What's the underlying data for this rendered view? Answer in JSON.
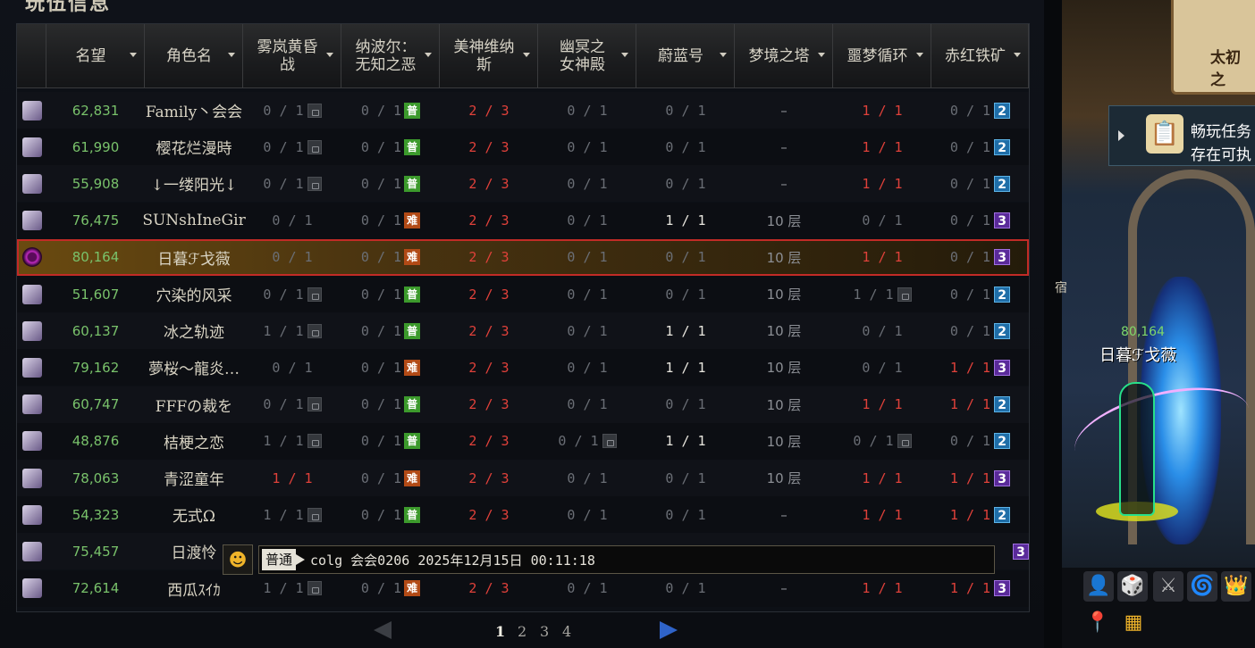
{
  "panel_title": "玩伍信息",
  "headers": [
    {
      "key": "avatar",
      "label": ""
    },
    {
      "key": "fame",
      "label": "名望"
    },
    {
      "key": "name",
      "label": "角色名"
    },
    {
      "key": "c1",
      "label": "雾岚黄昏\n战"
    },
    {
      "key": "c2",
      "label": "纳波尔：\n无知之恶"
    },
    {
      "key": "c3",
      "label": "美神维纳\n斯"
    },
    {
      "key": "c4",
      "label": "幽冥之\n女神殿"
    },
    {
      "key": "c5",
      "label": "蔚蓝号"
    },
    {
      "key": "c6",
      "label": "梦境之塔"
    },
    {
      "key": "c7",
      "label": "噩梦循环"
    },
    {
      "key": "c8",
      "label": "赤红铁矿"
    }
  ],
  "rows": [
    {
      "fame": "62,831",
      "name": "Family丶会会",
      "c1": "0 / 1",
      "c1_lock": true,
      "c2": "0 / 1",
      "c2_badge": "普",
      "c3": "2 / 3",
      "c4": "0 / 1",
      "c5": "0 / 1",
      "c6": "–",
      "c7": "1 / 1",
      "c8": "0 / 1",
      "lv": "2"
    },
    {
      "fame": "61,990",
      "name": "樱花烂漫時",
      "c1": "0 / 1",
      "c1_lock": true,
      "c2": "0 / 1",
      "c2_badge": "普",
      "c3": "2 / 3",
      "c4": "0 / 1",
      "c5": "0 / 1",
      "c6": "–",
      "c7": "1 / 1",
      "c8": "0 / 1",
      "lv": "2"
    },
    {
      "fame": "55,908",
      "name": "↓一缕阳光↓",
      "c1": "0 / 1",
      "c1_lock": true,
      "c2": "0 / 1",
      "c2_badge": "普",
      "c3": "2 / 3",
      "c4": "0 / 1",
      "c5": "0 / 1",
      "c6": "–",
      "c7": "1 / 1",
      "c8": "0 / 1",
      "lv": "2"
    },
    {
      "fame": "76,475",
      "name": "SUNshIneGir",
      "c1": "0 / 1",
      "c1_lock": false,
      "c2": "0 / 1",
      "c2_badge": "难",
      "c3": "2 / 3",
      "c4": "0 / 1",
      "c5": "1 / 1",
      "c6": "10 层",
      "c7": "0 / 1",
      "c8": "0 / 1",
      "lv": "3"
    },
    {
      "fame": "80,164",
      "name": "日暮ℱ戈薇",
      "c1": "0 / 1",
      "c1_lock": false,
      "c2": "0 / 1",
      "c2_badge": "难",
      "c3": "2 / 3",
      "c4": "0 / 1",
      "c5": "0 / 1",
      "c6": "10 层",
      "c7": "1 / 1",
      "c8": "0 / 1",
      "lv": "3",
      "selected": true
    },
    {
      "fame": "51,607",
      "name": "穴染的风采",
      "c1": "0 / 1",
      "c1_lock": true,
      "c2": "0 / 1",
      "c2_badge": "普",
      "c3": "2 / 3",
      "c4": "0 / 1",
      "c5": "0 / 1",
      "c6": "10 层",
      "c7": "1 / 1",
      "c7_lock": true,
      "c8": "0 / 1",
      "lv": "2"
    },
    {
      "fame": "60,137",
      "name": "冰之轨迹",
      "c1": "1 / 1",
      "c1_lock": true,
      "c2": "0 / 1",
      "c2_badge": "普",
      "c3": "2 / 3",
      "c4": "0 / 1",
      "c5": "1 / 1",
      "c6": "10 层",
      "c7": "0 / 1",
      "c8": "0 / 1",
      "lv": "2"
    },
    {
      "fame": "79,162",
      "name": "夢桜～龍炎…",
      "c1": "0 / 1",
      "c1_lock": false,
      "c2": "0 / 1",
      "c2_badge": "难",
      "c3": "2 / 3",
      "c4": "0 / 1",
      "c5": "1 / 1",
      "c6": "10 层",
      "c7": "0 / 1",
      "c8": "1 / 1",
      "lv": "3"
    },
    {
      "fame": "60,747",
      "name": "FFFの裁を",
      "c1": "0 / 1",
      "c1_lock": true,
      "c2": "0 / 1",
      "c2_badge": "普",
      "c3": "2 / 3",
      "c4": "0 / 1",
      "c5": "0 / 1",
      "c6": "10 层",
      "c7": "1 / 1",
      "c8": "1 / 1",
      "lv": "2"
    },
    {
      "fame": "48,876",
      "name": "桔梗之恋",
      "c1": "1 / 1",
      "c1_lock": true,
      "c2": "0 / 1",
      "c2_badge": "普",
      "c3": "2 / 3",
      "c4": "0 / 1",
      "c4_lock": true,
      "c5": "1 / 1",
      "c6": "10 层",
      "c7": "0 / 1",
      "c7_lock": true,
      "c8": "0 / 1",
      "lv": "2"
    },
    {
      "fame": "78,063",
      "name": "青涩童年",
      "c1": "1 / 1",
      "c1_lock": false,
      "c2": "0 / 1",
      "c2_badge": "难",
      "c3": "2 / 3",
      "c4": "0 / 1",
      "c5": "0 / 1",
      "c6": "10 层",
      "c7": "1 / 1",
      "c8": "1 / 1",
      "lv": "3"
    },
    {
      "fame": "54,323",
      "name": "无式Ω",
      "c1": "1 / 1",
      "c1_lock": true,
      "c2": "0 / 1",
      "c2_badge": "普",
      "c3": "2 / 3",
      "c4": "0 / 1",
      "c5": "0 / 1",
      "c6": "–",
      "c7": "1 / 1",
      "c8": "1 / 1",
      "lv": "2"
    },
    {
      "fame": "75,457",
      "name": "日渡怜",
      "lv": "3",
      "chat": true
    },
    {
      "fame": "72,614",
      "name": "西瓜ｽｲｶ",
      "c1": "1 / 1",
      "c1_lock": true,
      "c2": "0 / 1",
      "c2_badge": "难",
      "c3": "2 / 3",
      "c4": "0 / 1",
      "c5": "0 / 1",
      "c6": "–",
      "c7": "1 / 1",
      "c8": "1 / 1",
      "lv": "3"
    }
  ],
  "chat": {
    "channel": "普通",
    "message": "colg 会会0206 2025年12月15日 00:11:18"
  },
  "pager": {
    "pages": [
      "1",
      "2",
      "3",
      "4"
    ],
    "current": "1"
  },
  "scene": {
    "scroll_title": "太初之",
    "quest_line1": "畅玩任务",
    "quest_line2": "存在可执",
    "player_fame": "80,164",
    "player_name": "日暮ℱ戈薇",
    "side_hint": "宿"
  },
  "colors": {
    "fame": "#79c26b",
    "red": "#e0413a",
    "dim": "#6a6e75",
    "select_border": "#c22b26",
    "badge_normal": "#3c9a2c",
    "badge_hard": "#b24a16",
    "lv2": "#1f6ea8",
    "lv3": "#5a2a9a"
  }
}
